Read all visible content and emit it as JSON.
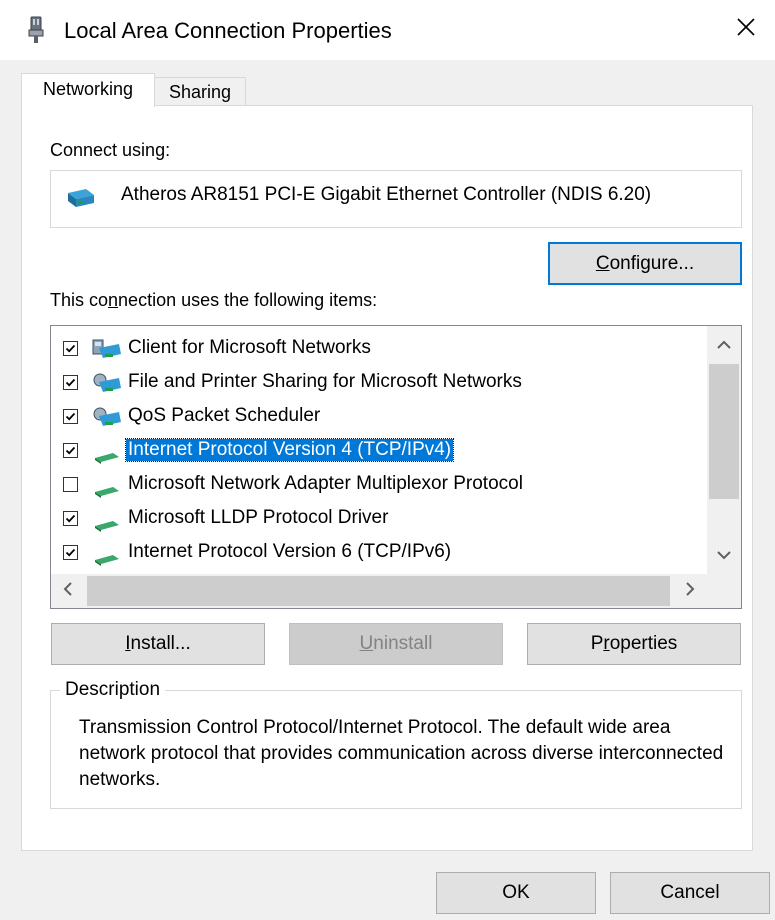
{
  "window": {
    "title": "Local Area Connection Properties",
    "close_glyph": "✕"
  },
  "tabs": [
    {
      "label": "Networking",
      "selected": true
    },
    {
      "label": "Sharing",
      "selected": false
    }
  ],
  "connect": {
    "label": "Connect using:",
    "adapter": "Atheros AR8151 PCI-E Gigabit Ethernet Controller (NDIS 6.20)",
    "adapter_icon": "network-adapter-icon"
  },
  "configure_button": {
    "pre": "",
    "key": "C",
    "post": "onfigure..."
  },
  "items_label": {
    "pre": "This co",
    "key": "n",
    "post": "nection uses the following items:"
  },
  "items": [
    {
      "label": "Client for Microsoft Networks",
      "checked": true,
      "icon": "client-network-icon",
      "selected": false
    },
    {
      "label": "File and Printer Sharing for Microsoft Networks",
      "checked": true,
      "icon": "service-network-icon",
      "selected": false
    },
    {
      "label": "QoS Packet Scheduler",
      "checked": true,
      "icon": "service-network-icon",
      "selected": false
    },
    {
      "label": "Internet Protocol Version 4 (TCP/IPv4)",
      "checked": true,
      "icon": "protocol-icon",
      "selected": true
    },
    {
      "label": "Microsoft Network Adapter Multiplexor Protocol",
      "checked": false,
      "icon": "protocol-icon",
      "selected": false
    },
    {
      "label": "Microsoft LLDP Protocol Driver",
      "checked": true,
      "icon": "protocol-icon",
      "selected": false
    },
    {
      "label": "Internet Protocol Version 6 (TCP/IPv6)",
      "checked": true,
      "icon": "protocol-icon",
      "selected": false
    }
  ],
  "buttons": {
    "install": {
      "key": "I",
      "post": "nstall..."
    },
    "uninstall": {
      "key": "U",
      "post": "ninstall",
      "enabled": false
    },
    "properties": {
      "pre": "P",
      "key": "r",
      "post": "operties"
    },
    "ok": "OK",
    "cancel": "Cancel"
  },
  "description": {
    "legend": "Description",
    "text": "Transmission Control Protocol/Internet Protocol. The default wide area network protocol that provides communication across diverse interconnected networks."
  },
  "colors": {
    "accent": "#0078d7",
    "window_bg": "#f0f0f0",
    "panel_bg": "#ffffff",
    "disabled_text": "#838383"
  }
}
